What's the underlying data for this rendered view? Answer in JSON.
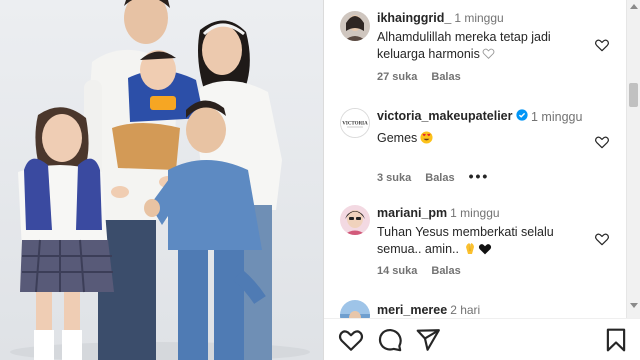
{
  "photo": {
    "description_icon": "family-photo"
  },
  "comments": [
    {
      "username": "ikhainggrid_",
      "time": "1 minggu",
      "text": "Alhamdulillah mereka tetap jadi keluarga harmonis",
      "text_trailing_icon": "white-heart-emoji",
      "likes": "27 suka",
      "reply": "Balas"
    },
    {
      "username": "victoria_makeupatelier",
      "verified_icon": "verified-badge-icon",
      "time": "1 minggu",
      "text": "Gemes",
      "text_trailing_icon": "heart-eyes-emoji",
      "likes": "3 suka",
      "reply": "Balas",
      "more": "•••"
    },
    {
      "username": "mariani_pm",
      "time": "1 minggu",
      "text": "Tuhan Yesus memberkati selalu semua.. amin..",
      "text_trailing_icon": "praying-hands-and-black-heart-emoji",
      "likes": "14 suka",
      "reply": "Balas"
    },
    {
      "username": "meri_meree",
      "time": "2 hari"
    }
  ],
  "actions": {
    "like_icon": "heart-outline-icon",
    "comment_icon": "comment-bubble-icon",
    "share_icon": "paper-plane-icon",
    "save_icon": "bookmark-icon"
  },
  "colors": {
    "text": "#262626",
    "secondary": "#737373",
    "verified": "#0095f6",
    "background": "#ffffff"
  }
}
